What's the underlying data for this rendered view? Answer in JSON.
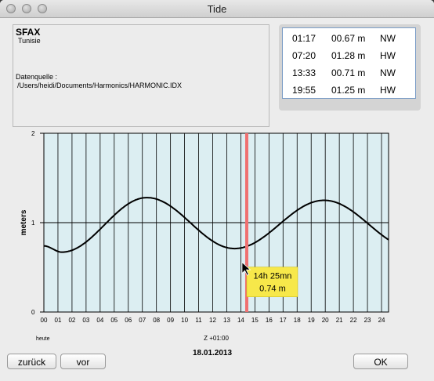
{
  "window": {
    "title": "Tide"
  },
  "station": {
    "name": "SFAX",
    "country": "Tunisie",
    "source_label": "Datenquelle :",
    "source_path": "/Users/heidi/Documents/Harmonics/HARMONIC.IDX"
  },
  "tides": [
    {
      "time": "01:17",
      "height": "00.67 m",
      "type": "NW"
    },
    {
      "time": "07:20",
      "height": "01.28 m",
      "type": "HW"
    },
    {
      "time": "13:33",
      "height": "00.71 m",
      "type": "NW"
    },
    {
      "time": "19:55",
      "height": "01.25 m",
      "type": "HW"
    }
  ],
  "chart_data": {
    "type": "line",
    "ylabel": "meters",
    "ylim": [
      0,
      2
    ],
    "yticks": [
      "0",
      "1",
      "2"
    ],
    "xlim": [
      0,
      24.5
    ],
    "xticks": [
      "00",
      "01",
      "02",
      "03",
      "04",
      "05",
      "06",
      "07",
      "08",
      "09",
      "10",
      "11",
      "12",
      "13",
      "14",
      "15",
      "16",
      "17",
      "18",
      "19",
      "20",
      "21",
      "22",
      "23",
      "24"
    ],
    "x_left_label": "heute",
    "x_center_label": "Z +01:00",
    "extremes": [
      {
        "t": 1.28,
        "h": 0.67
      },
      {
        "t": 7.33,
        "h": 1.28
      },
      {
        "t": 13.55,
        "h": 0.71
      },
      {
        "t": 19.92,
        "h": 1.25
      }
    ],
    "curve_start": {
      "t": 0,
      "h": 0.74
    },
    "curve_end": {
      "t": 24.5,
      "h": 0.82
    },
    "cursor": {
      "t": 14.42,
      "time_label": "14h 25mn",
      "height_label": "0.74 m"
    },
    "colors": {
      "background": "#dceef2",
      "cursor": "#f07070",
      "tooltip": "#f7e84a"
    }
  },
  "footer": {
    "back_label": "zurück",
    "forward_label": "vor",
    "date": "18.01.2013",
    "ok_label": "OK"
  }
}
